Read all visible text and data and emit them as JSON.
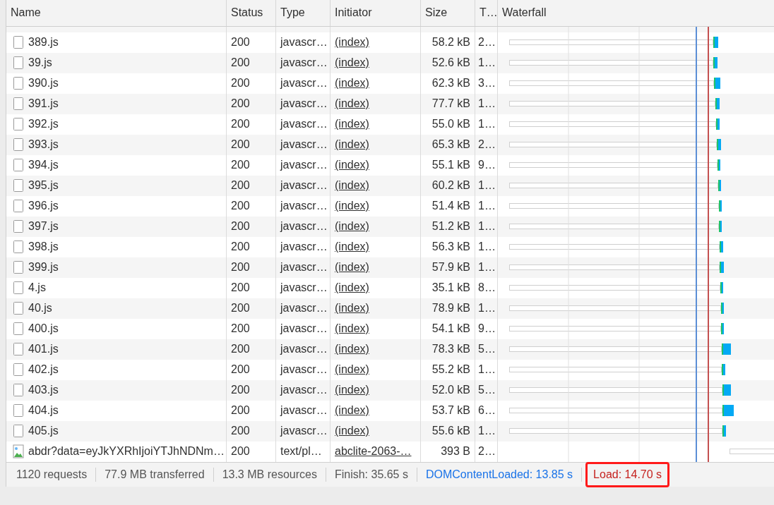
{
  "table": {
    "columns": [
      "Name",
      "Status",
      "Type",
      "Initiator",
      "Size",
      "T…",
      "Waterfall"
    ],
    "rows": [
      {
        "kind": "script",
        "name": "389.js",
        "status": "200",
        "type": "javascr…",
        "initiator": "(index)",
        "size": "58.2 kB",
        "time": "2…"
      },
      {
        "kind": "script",
        "name": "39.js",
        "status": "200",
        "type": "javascr…",
        "initiator": "(index)",
        "size": "52.6 kB",
        "time": "1…"
      },
      {
        "kind": "script",
        "name": "390.js",
        "status": "200",
        "type": "javascr…",
        "initiator": "(index)",
        "size": "62.3 kB",
        "time": "3…"
      },
      {
        "kind": "script",
        "name": "391.js",
        "status": "200",
        "type": "javascr…",
        "initiator": "(index)",
        "size": "77.7 kB",
        "time": "1…"
      },
      {
        "kind": "script",
        "name": "392.js",
        "status": "200",
        "type": "javascr…",
        "initiator": "(index)",
        "size": "55.0 kB",
        "time": "1…"
      },
      {
        "kind": "script",
        "name": "393.js",
        "status": "200",
        "type": "javascr…",
        "initiator": "(index)",
        "size": "65.3 kB",
        "time": "2…"
      },
      {
        "kind": "script",
        "name": "394.js",
        "status": "200",
        "type": "javascr…",
        "initiator": "(index)",
        "size": "55.1 kB",
        "time": "9…"
      },
      {
        "kind": "script",
        "name": "395.js",
        "status": "200",
        "type": "javascr…",
        "initiator": "(index)",
        "size": "60.2 kB",
        "time": "1…"
      },
      {
        "kind": "script",
        "name": "396.js",
        "status": "200",
        "type": "javascr…",
        "initiator": "(index)",
        "size": "51.4 kB",
        "time": "1…"
      },
      {
        "kind": "script",
        "name": "397.js",
        "status": "200",
        "type": "javascr…",
        "initiator": "(index)",
        "size": "51.2 kB",
        "time": "1…"
      },
      {
        "kind": "script",
        "name": "398.js",
        "status": "200",
        "type": "javascr…",
        "initiator": "(index)",
        "size": "56.3 kB",
        "time": "1…"
      },
      {
        "kind": "script",
        "name": "399.js",
        "status": "200",
        "type": "javascr…",
        "initiator": "(index)",
        "size": "57.9 kB",
        "time": "1…"
      },
      {
        "kind": "script",
        "name": "4.js",
        "status": "200",
        "type": "javascr…",
        "initiator": "(index)",
        "size": "35.1 kB",
        "time": "8…"
      },
      {
        "kind": "script",
        "name": "40.js",
        "status": "200",
        "type": "javascr…",
        "initiator": "(index)",
        "size": "78.9 kB",
        "time": "1…"
      },
      {
        "kind": "script",
        "name": "400.js",
        "status": "200",
        "type": "javascr…",
        "initiator": "(index)",
        "size": "54.1 kB",
        "time": "9…"
      },
      {
        "kind": "script",
        "name": "401.js",
        "status": "200",
        "type": "javascr…",
        "initiator": "(index)",
        "size": "78.3 kB",
        "time": "5…"
      },
      {
        "kind": "script",
        "name": "402.js",
        "status": "200",
        "type": "javascr…",
        "initiator": "(index)",
        "size": "55.2 kB",
        "time": "1…"
      },
      {
        "kind": "script",
        "name": "403.js",
        "status": "200",
        "type": "javascr…",
        "initiator": "(index)",
        "size": "52.0 kB",
        "time": "5…"
      },
      {
        "kind": "script",
        "name": "404.js",
        "status": "200",
        "type": "javascr…",
        "initiator": "(index)",
        "size": "53.7 kB",
        "time": "6…"
      },
      {
        "kind": "script",
        "name": "405.js",
        "status": "200",
        "type": "javascr…",
        "initiator": "(index)",
        "size": "55.6 kB",
        "time": "1…"
      },
      {
        "kind": "image",
        "name": "abdr?data=eyJkYXRhIjoiYTJhNDNm…",
        "status": "200",
        "type": "text/pl…",
        "initiator": "abclite-2063-…",
        "size": "393 B",
        "time": "2…"
      }
    ]
  },
  "status_bar": [
    {
      "text": "1120 requests",
      "color": "#555555",
      "highlighted": false
    },
    {
      "text": "77.9 MB transferred",
      "color": "#555555",
      "highlighted": false
    },
    {
      "text": "13.3 MB resources",
      "color": "#555555",
      "highlighted": false
    },
    {
      "text": "Finish: 35.65 s",
      "color": "#555555",
      "highlighted": false
    },
    {
      "text": "DOMContentLoaded: 13.85 s",
      "color": "#1a73e8",
      "highlighted": false
    },
    {
      "text": "Load: 14.70 s",
      "color": "#c5221f",
      "highlighted": true
    }
  ]
}
